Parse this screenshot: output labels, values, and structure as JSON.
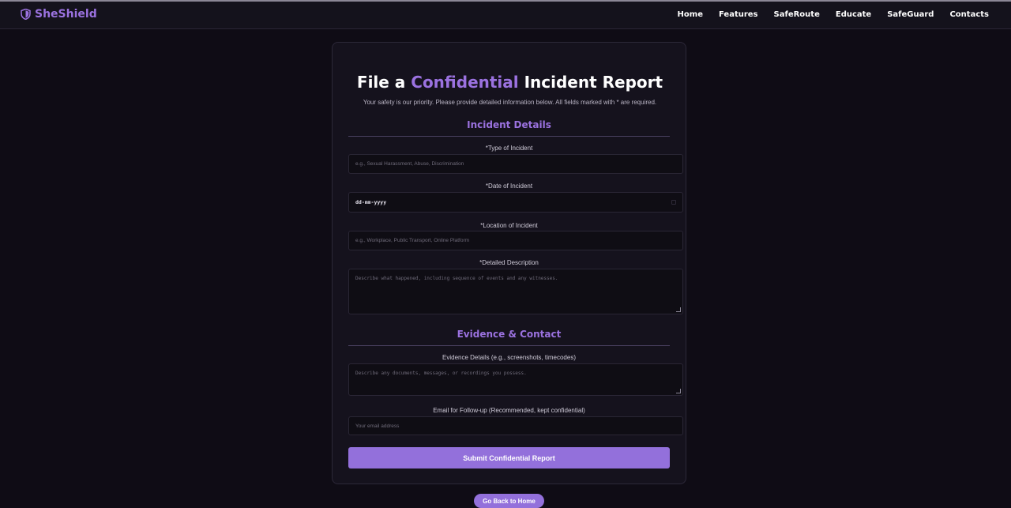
{
  "brand": {
    "name": "SheShield",
    "icon": "shield-icon",
    "color": "#9b72e0"
  },
  "nav": {
    "items": [
      {
        "label": "Home"
      },
      {
        "label": "Features"
      },
      {
        "label": "SafeRoute"
      },
      {
        "label": "Educate"
      },
      {
        "label": "SafeGuard"
      },
      {
        "label": "Contacts"
      }
    ]
  },
  "form": {
    "title_start": "File a ",
    "title_accent": "Confidential",
    "title_end": " Incident Report",
    "subtitle": "Your safety is our priority. Please provide detailed information below. All fields marked with * are required.",
    "section_incident": "Incident Details",
    "type_label": "*Type of Incident",
    "type_placeholder": "e.g., Sexual Harassment, Abuse, Discrimination",
    "date_label": "*Date of Incident",
    "date_value": "dd-mm-yyyy",
    "location_label": "*Location of Incident",
    "location_placeholder": "e.g., Workplace, Public Transport, Online Platform",
    "description_label": "*Detailed Description",
    "description_placeholder": "Describe what happened, including sequence of events and any witnesses.",
    "section_evidence": "Evidence & Contact",
    "evidence_label": "Evidence Details (e.g., screenshots, timecodes)",
    "evidence_placeholder": "Describe any documents, messages, or recordings you possess.",
    "email_label": "Email for Follow-up (Recommended, kept confidential)",
    "email_placeholder": "Your email address",
    "submit_label": "Submit Confidential Report"
  },
  "back_label": "Go Back to Home",
  "colors": {
    "accent": "#9370db",
    "background": "#0f0c15",
    "card": "#15121d"
  }
}
